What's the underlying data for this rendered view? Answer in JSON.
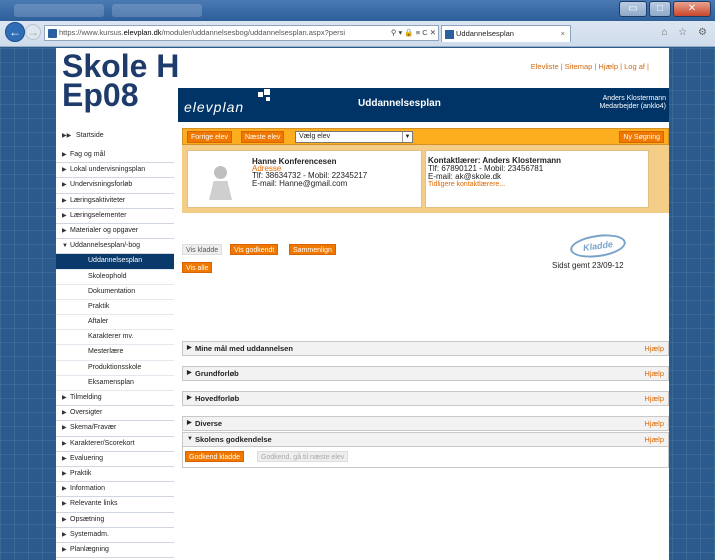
{
  "browser": {
    "url_prefix": "https://www.kursus.",
    "url_domain": "elevplan.dk",
    "url_rest": "/moduler/uddannelsesbog/uddannelsesplan.aspx?persi",
    "url_controls": "⚲ ▾ 🔒 ≡ C ✕",
    "tab_title": "Uddannelsesplan",
    "tab_close": "×",
    "icons": "⌂ ☆ ⚙"
  },
  "school": {
    "line1": "Skole H",
    "line2": "Ep08"
  },
  "toplinks": "Elevliste | Sitemap | Hjælp | Log af |",
  "banner": {
    "logo": "elevplan",
    "title": "Uddannelsesplan",
    "user_name": "Anders Klostermann",
    "user_role": "Medarbejder (anklo4)"
  },
  "sidebar": [
    {
      "label": "Startside",
      "arrow": "▶▶",
      "kind": "top"
    },
    {
      "label": "Fag og mål",
      "arrow": "▶",
      "kind": "item"
    },
    {
      "label": "Lokal undervisningsplan",
      "arrow": "▶",
      "kind": "item"
    },
    {
      "label": "Undervisningsforløb",
      "arrow": "▶",
      "kind": "item"
    },
    {
      "label": "Læringsaktiviteter",
      "arrow": "▶",
      "kind": "item"
    },
    {
      "label": "Læringselementer",
      "arrow": "▶",
      "kind": "item"
    },
    {
      "label": "Materialer og opgaver",
      "arrow": "▶",
      "kind": "item"
    },
    {
      "label": "Uddannelsesplan/-bog",
      "arrow": "▼",
      "kind": "item"
    },
    {
      "label": "Uddannelsesplan",
      "arrow": "",
      "kind": "active"
    },
    {
      "label": "Skoleophold",
      "arrow": "",
      "kind": "sub"
    },
    {
      "label": "Dokumentation",
      "arrow": "",
      "kind": "sub"
    },
    {
      "label": "Praktik",
      "arrow": "",
      "kind": "sub"
    },
    {
      "label": "Aftaler",
      "arrow": "",
      "kind": "sub"
    },
    {
      "label": "Karakterer mv.",
      "arrow": "",
      "kind": "sub"
    },
    {
      "label": "Mesterlære",
      "arrow": "",
      "kind": "sub"
    },
    {
      "label": "Produktionsskole",
      "arrow": "",
      "kind": "sub"
    },
    {
      "label": "Eksamensplan",
      "arrow": "",
      "kind": "sub"
    },
    {
      "label": "Tilmelding",
      "arrow": "▶",
      "kind": "item"
    },
    {
      "label": "Oversigter",
      "arrow": "▶",
      "kind": "item"
    },
    {
      "label": "Skema/Fravær",
      "arrow": "▶",
      "kind": "item"
    },
    {
      "label": "Karakterer/Scorekort",
      "arrow": "▶",
      "kind": "item"
    },
    {
      "label": "Evaluering",
      "arrow": "▶",
      "kind": "item"
    },
    {
      "label": "Praktik",
      "arrow": "▶",
      "kind": "item"
    },
    {
      "label": "Information",
      "arrow": "▶",
      "kind": "item"
    },
    {
      "label": "Relevante links",
      "arrow": "▶",
      "kind": "item"
    },
    {
      "label": "Opsætning",
      "arrow": "▶",
      "kind": "item"
    },
    {
      "label": "Systemadm.",
      "arrow": "▶",
      "kind": "item"
    },
    {
      "label": "Planlægning",
      "arrow": "▶",
      "kind": "item"
    }
  ],
  "studentbar": {
    "prev": "Forrige elev",
    "next": "Næste elev",
    "select_value": "Vælg elev",
    "new_search": "Ny Søgning"
  },
  "student": {
    "name": "Hanne Konferencesen",
    "address_link": "Adresse",
    "phone": "Tlf: 38634732 - Mobil: 22345217",
    "email": "E-mail: Hanne@gmail.com"
  },
  "contact": {
    "title": "Kontaktlærer: Anders Klostermann",
    "phone": "Tlf: 67890121 - Mobil: 23456781",
    "email": "E-mail: ak@skole.dk",
    "previous_link": "Tidligere kontaktlærere..."
  },
  "actions": {
    "vis_kladde": "Vis kladde",
    "vis_godkendt": "Vis godkendt",
    "sammenlign": "Sammenlign",
    "vis_alle": "Vis alle"
  },
  "stamp": "Kladde",
  "saved": "Sidst gemt 23/09-12",
  "sections": [
    {
      "title": "Mine mål med uddannelsen",
      "help": "Hjælp",
      "expanded": false
    },
    {
      "title": "Grundforløb",
      "help": "Hjælp",
      "expanded": false
    },
    {
      "title": "Hovedforløb",
      "help": "Hjælp",
      "expanded": false
    },
    {
      "title": "Diverse",
      "help": "Hjælp",
      "expanded": false
    },
    {
      "title": "Skolens godkendelse",
      "help": "Hjælp",
      "expanded": true
    }
  ],
  "approve": {
    "approve_draft": "Godkend kladde",
    "approve_next": "Godkend, gå til næste elev"
  },
  "colors": {
    "accent": "#f07800",
    "banner": "#003366",
    "link": "#e06a00"
  }
}
